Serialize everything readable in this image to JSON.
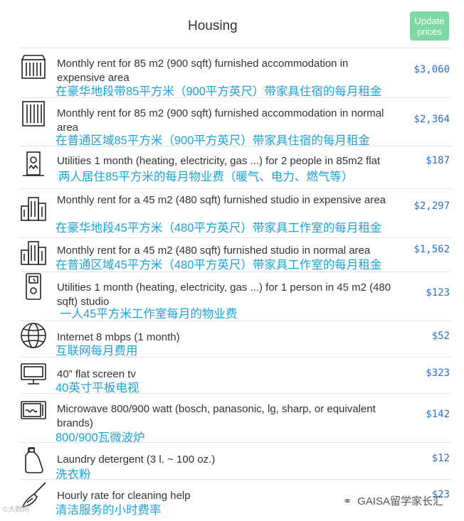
{
  "header": {
    "title": "Housing",
    "update_label": "Update prices",
    "update_color": "#7dd8a2"
  },
  "colors": {
    "price": "#2a6fd6",
    "translation": "#1ea1d9"
  },
  "items": [
    {
      "icon": "apartment-building-icon",
      "desc": "Monthly rent for 85 m2 (900 sqft) furnished accommodation in expensive area",
      "cn": "在豪华地段带85平方米（900平方英尺）带家具住宿的每月租金",
      "price": "$3,060"
    },
    {
      "icon": "office-building-icon",
      "desc": "Monthly rent for 85 m2 (900 sqft) furnished accommodation in normal area",
      "cn": "在普通区域85平方米（900平方英尺）带家具住宿的每月租金",
      "price": "$2,364"
    },
    {
      "icon": "utility-meter-icon",
      "desc": "Utilities 1 month (heating, electricity, gas ...) for 2 people in 85m2 flat",
      "cn": "两人居住85平方米的每月物业费（暖气、电力、燃气等）",
      "price": "$187"
    },
    {
      "icon": "city-buildings-icon",
      "desc": "Monthly rent for a 45 m2 (480 sqft) furnished studio in expensive area",
      "cn": "在豪华地段45平方米（480平方英尺）带家具工作室的每月租金",
      "price": "$2,297"
    },
    {
      "icon": "city-buildings-icon",
      "desc": "Monthly rent for a 45 m2 (480 sqft) furnished studio in normal area",
      "cn": "在普通区域45平方米（480平方英尺）带家具工作室的每月租金",
      "price": "$1,562"
    },
    {
      "icon": "electric-meter-icon",
      "desc": "Utilities 1 month (heating, electricity, gas ...) for 1 person in 45 m2 (480 sqft) studio",
      "cn": "一人45平方米工作室每月的物业费",
      "price": "$123"
    },
    {
      "icon": "globe-icon",
      "desc": "Internet 8 mbps (1 month)",
      "cn": "互联网每月费用",
      "price": "$52"
    },
    {
      "icon": "tv-icon",
      "desc": "40” flat screen tv",
      "cn": "40英寸平板电视",
      "price": "$323"
    },
    {
      "icon": "microwave-icon",
      "desc": "Microwave 800/900 watt (bosch, panasonic, lg, sharp, or equivalent brands)",
      "cn": "800/900瓦微波炉",
      "price": "$142"
    },
    {
      "icon": "detergent-bottle-icon",
      "desc": "Laundry detergent (3 l. ~ 100 oz.)",
      "cn": "洗衣粉",
      "price": "$12"
    },
    {
      "icon": "broom-icon",
      "desc": "Hourly rate for cleaning help",
      "cn": "清洁服务的小时费率",
      "price": "$23"
    }
  ],
  "watermark": {
    "text": "GAISA留学家长汇",
    "icon": "wechat-icon"
  },
  "corner_mark": "©大数网"
}
